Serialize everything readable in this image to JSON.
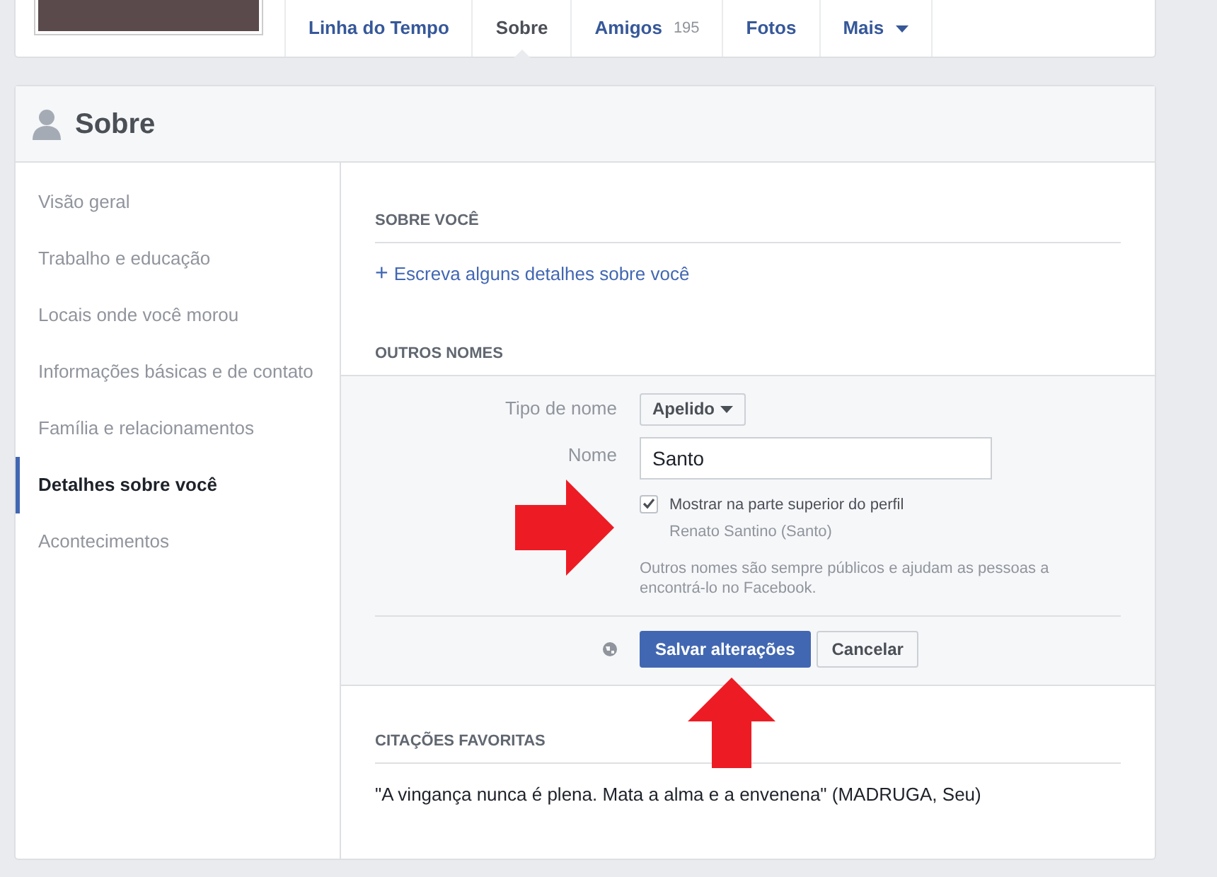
{
  "tabs": [
    {
      "label": "Linha do Tempo",
      "selected": false
    },
    {
      "label": "Sobre",
      "selected": true
    },
    {
      "label": "Amigos",
      "count": "195",
      "selected": false
    },
    {
      "label": "Fotos",
      "selected": false
    },
    {
      "label": "Mais",
      "caret": true,
      "selected": false
    }
  ],
  "about": {
    "title": "Sobre",
    "sidebar": [
      {
        "label": "Visão geral",
        "selected": false
      },
      {
        "label": "Trabalho e educação",
        "selected": false
      },
      {
        "label": "Locais onde você morou",
        "selected": false
      },
      {
        "label": "Informações básicas e de contato",
        "selected": false
      },
      {
        "label": "Família e relacionamentos",
        "selected": false
      },
      {
        "label": "Detalhes sobre você",
        "selected": true
      },
      {
        "label": "Acontecimentos",
        "selected": false
      }
    ],
    "about_you": {
      "heading": "SOBRE VOCÊ",
      "link_icon": "+",
      "link": "Escreva alguns detalhes sobre você"
    },
    "other_names": {
      "heading": "OUTROS NOMES",
      "type_label": "Tipo de nome",
      "type_value": "Apelido",
      "name_label": "Nome",
      "name_value": "Santo",
      "show_on_top": {
        "label": "Mostrar na parte superior do perfil",
        "checked": true
      },
      "preview": "Renato Santino (Santo)",
      "note": "Outros nomes são sempre públicos e ajudam as pessoas a encontrá-lo no Facebook.",
      "save": "Salvar alterações",
      "cancel": "Cancelar"
    },
    "quotes": {
      "heading": "CITAÇÕES FAVORITAS",
      "text": "\"A vingança nunca é plena. Mata a alma e a envenena\" (MADRUGA, Seu)"
    }
  }
}
